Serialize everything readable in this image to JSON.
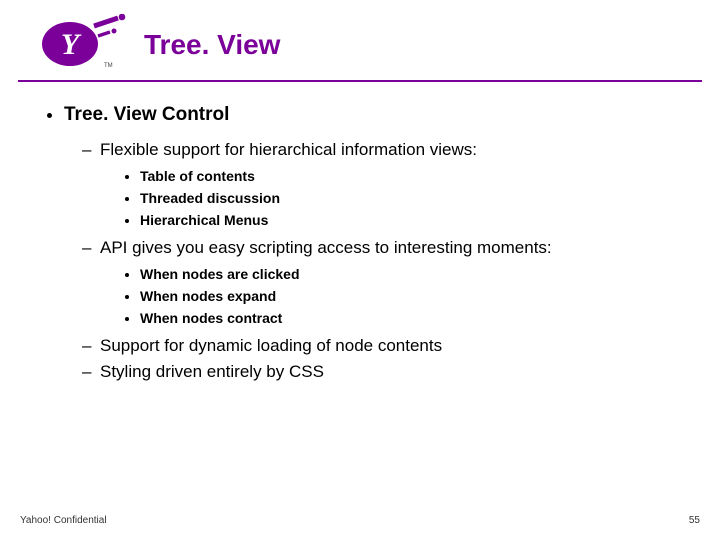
{
  "header": {
    "title": "Tree. View",
    "logo_letter": "Y",
    "logo_tm": "TM"
  },
  "content": {
    "heading": "Tree. View Control",
    "sections": [
      {
        "text": "Flexible support for hierarchical information views:",
        "items": [
          "Table of contents",
          "Threaded discussion",
          "Hierarchical Menus"
        ]
      },
      {
        "text": "API gives you easy scripting access to interesting moments:",
        "items": [
          "When nodes are clicked",
          "When nodes expand",
          "When nodes contract"
        ]
      },
      {
        "text": "Support for dynamic loading of node contents"
      },
      {
        "text": "Styling driven entirely by CSS"
      }
    ]
  },
  "footer": {
    "left": "Yahoo! Confidential",
    "right": "55"
  }
}
